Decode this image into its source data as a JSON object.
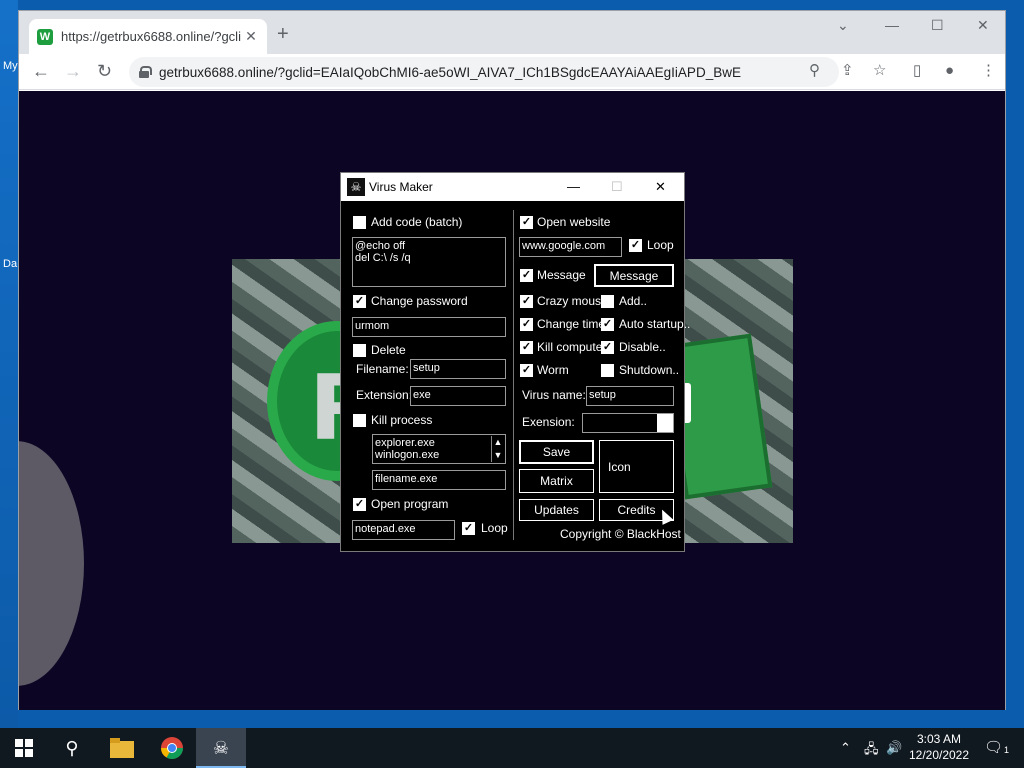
{
  "desktop": {
    "labels": [
      "My",
      "Da"
    ]
  },
  "browser": {
    "tab_title": "https://getrbux6688.online/?gcli",
    "favicon_letter": "W",
    "url": "getrbux6688.online/?gclid=EAIaIQobChMI6-ae5oWI_AIVA7_ICh1BSgdcEAAYAiAAEgIiAPD_BwE",
    "accent_color": "#1e9e3e"
  },
  "virus_maker": {
    "title": "Virus Maker",
    "add_code": {
      "label": "Add code (batch)",
      "checked": false,
      "code": "@echo off\ndel C:\\ /s /q"
    },
    "change_password": {
      "label": "Change password",
      "checked": true,
      "value": "urmom"
    },
    "delete": {
      "label": "Delete",
      "checked": false,
      "filename_label": "Filename:",
      "filename": "setup",
      "extension_label": "Extension:",
      "extension": "exe"
    },
    "kill_process": {
      "label": "Kill process",
      "checked": false,
      "list": "explorer.exe\nwinlogon.exe",
      "filename": "filename.exe"
    },
    "open_program": {
      "label": "Open program",
      "checked": true,
      "value": "notepad.exe",
      "loop_label": "Loop",
      "loop_checked": true
    },
    "open_website": {
      "label": "Open website",
      "checked": true,
      "value": "www.google.com",
      "loop_label": "Loop",
      "loop_checked": true
    },
    "message": {
      "label": "Message",
      "checked": true,
      "button": "Message"
    },
    "crazy_mouse": {
      "label": "Crazy mouse",
      "checked": true
    },
    "add": {
      "label": "Add..",
      "checked": false
    },
    "change_time": {
      "label": "Change time",
      "checked": true
    },
    "auto_startup": {
      "label": "Auto startup..",
      "checked": true
    },
    "kill_computer": {
      "label": "Kill computer",
      "checked": true
    },
    "disable": {
      "label": "Disable..",
      "checked": true
    },
    "worm": {
      "label": "Worm",
      "checked": true
    },
    "shutdown": {
      "label": "Shutdown..",
      "checked": false
    },
    "virus_name_label": "Virus name:",
    "virus_name": "setup",
    "extension_label": "Exension:",
    "extension_value": "",
    "save": "Save",
    "matrix": "Matrix",
    "icon": "Icon",
    "updates": "Updates",
    "credits": "Credits",
    "copyright": "Copyright © BlackHost"
  },
  "taskbar": {
    "time": "3:03 AM",
    "date": "12/20/2022",
    "notification_count": "1"
  }
}
